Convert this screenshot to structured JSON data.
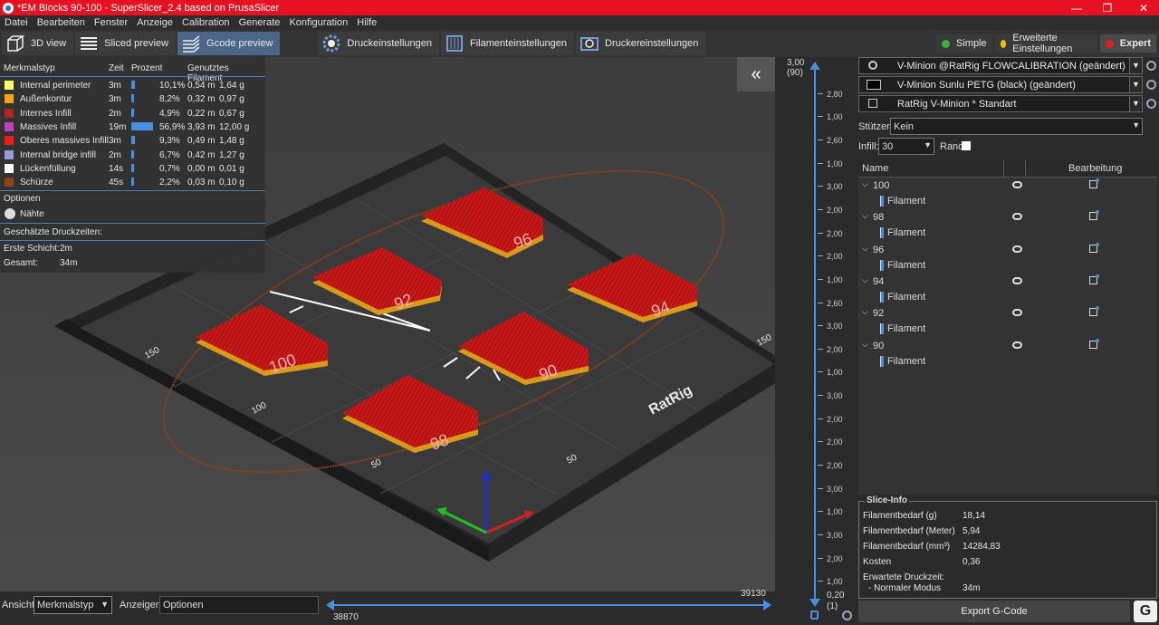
{
  "window": {
    "title": "*EM Blocks 90-100 - SuperSlicer_2.4  based on PrusaSlicer",
    "controls": [
      "—",
      "❐",
      "✕"
    ]
  },
  "menu": [
    "Datei",
    "Bearbeiten",
    "Fenster",
    "Anzeige",
    "Calibration",
    "Generate",
    "Konfiguration",
    "Hilfe"
  ],
  "tabs": [
    "3D view",
    "Sliced preview",
    "Gcode preview",
    "Druckeinstellungen",
    "Filamenteinstellungen",
    "Druckereinstellungen"
  ],
  "modes": [
    {
      "label": "Simple",
      "color": "#3db33d"
    },
    {
      "label": "Erweiterte Einstellungen",
      "color": "#e8c500"
    },
    {
      "label": "Expert",
      "color": "#e22222"
    }
  ],
  "legend": {
    "headers": [
      "Merkmalstyp",
      "Zeit",
      "Prozent",
      "Genutztes Filament"
    ],
    "rows": [
      {
        "name": "Internal perimeter",
        "color": "#ffff66",
        "time": "3m",
        "pct": "10,1%",
        "fraction": 0.101,
        "m": "0,54 m",
        "g": "1,64 g"
      },
      {
        "name": "Außenkontur",
        "color": "#ffa500",
        "time": "3m",
        "pct": "8,2%",
        "fraction": 0.082,
        "m": "0,32 m",
        "g": "0,97 g"
      },
      {
        "name": "Internes Infill",
        "color": "#b22222",
        "time": "2m",
        "pct": "4,9%",
        "fraction": 0.049,
        "m": "0,22 m",
        "g": "0,67 g"
      },
      {
        "name": "Massives Infill",
        "color": "#c040c0",
        "time": "19m",
        "pct": "56,9%",
        "fraction": 0.569,
        "m": "3,93 m",
        "g": "12,00 g"
      },
      {
        "name": "Oberes massives Infill",
        "color": "#ee1c1c",
        "time": "3m",
        "pct": "9,3%",
        "fraction": 0.093,
        "m": "0,49 m",
        "g": "1,48 g"
      },
      {
        "name": "Internal bridge infill",
        "color": "#9999dd",
        "time": "2m",
        "pct": "6,7%",
        "fraction": 0.067,
        "m": "0,42 m",
        "g": "1,27 g"
      },
      {
        "name": "Lückenfüllung",
        "color": "#ffffff",
        "time": "14s",
        "pct": "0,7%",
        "fraction": 0.007,
        "m": "0,00 m",
        "g": "0,01 g"
      },
      {
        "name": "Schürze",
        "color": "#8b4513",
        "time": "45s",
        "pct": "2,2%",
        "fraction": 0.022,
        "m": "0,03 m",
        "g": "0,10 g"
      }
    ],
    "options_label": "Optionen",
    "seams": "Nähte",
    "est_label": "Geschätzte Druckzeiten:",
    "first_layer_label": "Erste Schicht:",
    "first_layer": "2m",
    "total_label": "Gesamt:",
    "total": "34m"
  },
  "bed": {
    "logo": "RatRig",
    "axis_labels": [
      "150",
      "100",
      "50",
      "50",
      "150"
    ],
    "parts": [
      "100",
      "98",
      "96",
      "94",
      "92",
      "90"
    ]
  },
  "vslider": {
    "top": "3,00",
    "top2": "(90)",
    "bottom": "0,20",
    "bottom2": "(1)",
    "ticks": [
      "3,00",
      "2,80",
      "1,00",
      "2,60",
      "1,00",
      "3,00",
      "2,00",
      "2,00",
      "2,00",
      "1,00",
      "2,60",
      "3,00",
      "2,00",
      "1,00",
      "3,00",
      "2,00",
      "2,00",
      "2,00",
      "3,00",
      "1,00",
      "3,00",
      "2,00",
      "1,00",
      "0,20"
    ]
  },
  "right": {
    "print_profile": "V-Minion @RatRig FLOWCALIBRATION (geändert)",
    "filament_profile": "V-Minion Sunlu PETG (black) (geändert)",
    "printer_profile": "RatRig V-Minion * Standart",
    "supports_label": "Stützen:",
    "supports_value": "Kein",
    "infill_label": "Infill:",
    "infill_value": "30",
    "brim_label": "Rand:",
    "tree_headers": [
      "Name",
      "Bearbeitung"
    ],
    "objects": [
      "100",
      "98",
      "96",
      "94",
      "92",
      "90"
    ],
    "child_label": "Filament",
    "slice_title": "Slice-Info",
    "info": [
      {
        "k": "Filamentbedarf (g)",
        "v": "18,14"
      },
      {
        "k": "Filamentbedarf (Meter)",
        "v": "5,94"
      },
      {
        "k": "Filamentbedarf (mm³)",
        "v": "14284,83"
      },
      {
        "k": "Kosten",
        "v": "0,36"
      }
    ],
    "print_time_label": "Erwartete Druckzeit:",
    "normal_mode_label": "- Normaler Modus",
    "normal_mode": "34m",
    "export": "Export G-Code"
  },
  "bottom": {
    "view_label": "Ansicht",
    "view_value": "Merkmalstyp",
    "show_label": "Anzeigen",
    "show_value": "Optionen",
    "h_max": "39130",
    "h_min": "38870"
  }
}
